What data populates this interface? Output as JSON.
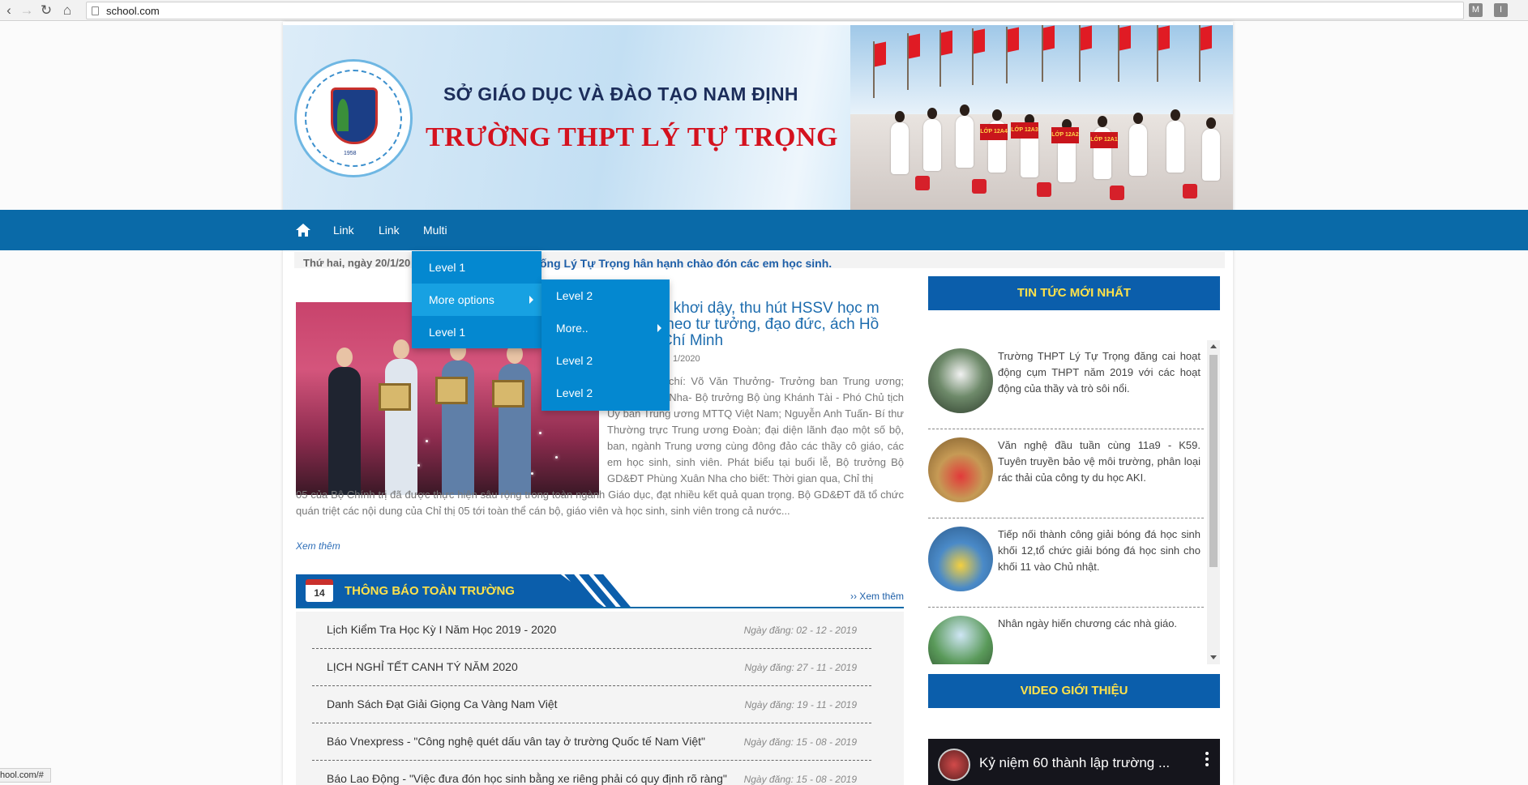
{
  "browser": {
    "url": "school.com",
    "extensions": [
      "M",
      "I"
    ]
  },
  "banner": {
    "department": "SỞ GIÁO DỤC VÀ ĐÀO TẠO NAM ĐỊNH",
    "school": "TRƯỜNG THPT LÝ TỰ TRỌNG",
    "logo_year": "1958",
    "signs": [
      "LỚP 12A4",
      "LỚP 12A3",
      "LỚP 12A2",
      "LỚP 12A1"
    ]
  },
  "navbar": {
    "items": [
      "Link",
      "Link",
      "Multi Level"
    ]
  },
  "dropdown": {
    "level1": [
      {
        "label": "Level 1",
        "submenu": false
      },
      {
        "label": "More options",
        "submenu": true
      },
      {
        "label": "Level 1",
        "submenu": false
      }
    ],
    "level2": [
      {
        "label": "Level 2",
        "submenu": false
      },
      {
        "label": "More..",
        "submenu": true
      },
      {
        "label": "Level 2",
        "submenu": false
      },
      {
        "label": "Level 2",
        "submenu": false
      }
    ]
  },
  "date_line": "Thứ hai, ngày 20/1/20",
  "marquee": "ống Lý Tự Trọng hân hạnh chào đón các em học sinh.",
  "feature": {
    "title": "c khơi dậy, thu hút HSSV học m theo tư tưởng, đạo đức, ách Hồ Chí Minh",
    "date": "1/2020",
    "body_side": "ó các đồng chí: Võ Văn Thưởng- Trưởng ban Trung ương; Phùng Xuân Nha- Bộ trưởng Bộ ùng Khánh Tài - Phó Chủ tịch Ủy ban Trung ương MTTQ Việt Nam; Nguyễn Anh Tuấn- Bí thư Thường trực Trung ương Đoàn; đại diện lãnh đạo một số bộ, ban, ngành Trung ương cùng đông đảo các thầy cô giáo, các em học sinh, sinh viên. Phát biểu tại buổi lễ, Bộ trưởng Bộ GD&ĐT Phùng Xuân Nha cho biết: Thời gian qua, Chỉ thị",
    "body_full": "05 của Bộ Chính trị đã được thực hiện sâu rộng trong toàn ngành Giáo dục, đạt nhiều kết quả quan trọng. Bộ GD&ĐT đã tổ chức quán triệt các nội dung của Chỉ thị 05 tới toàn thể cán bộ, giáo viên và học sinh, sinh viên trong cả nước...",
    "more": "Xem thêm"
  },
  "notices": {
    "day": "14",
    "title": "THÔNG BÁO TOÀN TRƯỜNG",
    "see_more": "›› Xem thêm",
    "rows": [
      {
        "title": "Lịch Kiểm Tra Học Kỳ I Năm Học 2019 - 2020",
        "date": "Ngày đăng: 02 - 12 - 2019"
      },
      {
        "title": "LỊCH NGHỈ TẾT CANH TÝ NĂM 2020",
        "date": "Ngày đăng: 27 - 11 - 2019"
      },
      {
        "title": "Danh Sách Đạt Giải Giọng Ca Vàng Nam Việt",
        "date": "Ngày đăng: 19 - 11 - 2019"
      },
      {
        "title": "Báo Vnexpress - \"Công nghệ quét dấu vân tay ở trường Quốc tế Nam Việt\"",
        "date": "Ngày đăng: 15 - 08 - 2019"
      },
      {
        "title": "Báo Lao Động - \"Việc đưa đón học sinh bằng xe riêng phải có quy định rõ ràng\"",
        "date": "Ngày đăng: 15 - 08 - 2019"
      }
    ]
  },
  "sidebar": {
    "news_title": "TIN TỨC MỚI NHẤT",
    "news": [
      {
        "text": "Trường THPT Lý Tự Trọng đăng cai hoạt động cụm THPT năm 2019 với các hoạt động của thầy và trò sôi nổi."
      },
      {
        "text": "Văn nghệ đầu tuần cùng 11a9 - K59. Tuyên truyền bảo vệ môi trường, phân loại rác thải của công ty du học AKI."
      },
      {
        "text": "Tiếp nối thành công giải bóng đá học sinh khối 12,tổ chức giải bóng đá học sinh cho khối 11 vào Chủ nhật."
      },
      {
        "text": "Nhân ngày hiến chương các nhà giáo."
      }
    ],
    "video_title": "VIDEO GIỚI THIỆU",
    "video_caption": "Kỷ niệm 60 thành lập trường ..."
  },
  "status_url": "hool.com/#",
  "colors": {
    "navbar": "#0a6aa8",
    "dropdown": "#0488d0",
    "dropdown_active": "#17a1e2",
    "section_header": "#0b5eab",
    "header_text": "#ffe24a",
    "banner_title": "#d4121f"
  }
}
